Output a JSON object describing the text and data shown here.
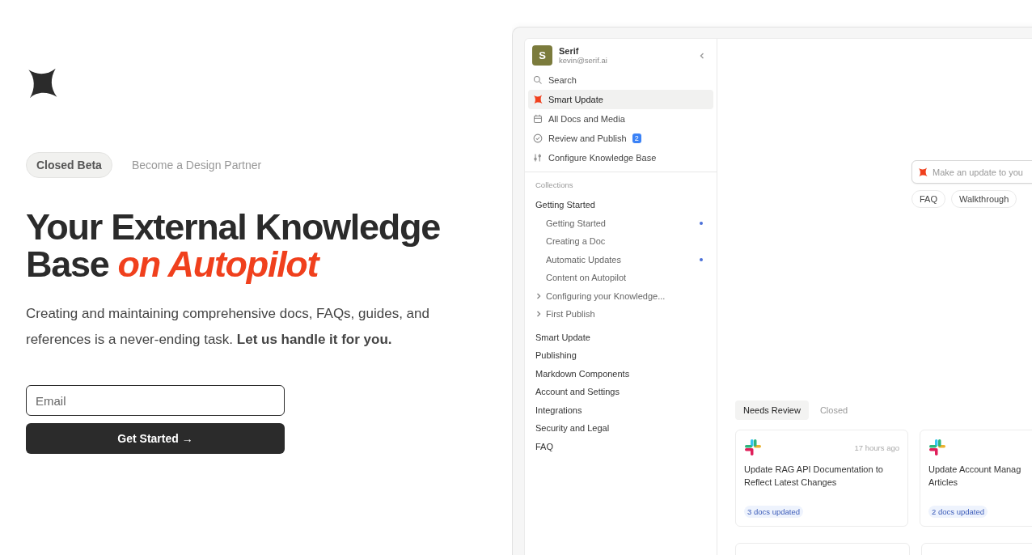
{
  "hero": {
    "tags": [
      {
        "label": "Closed Beta",
        "kind": "badge"
      },
      {
        "label": "Become a Design Partner",
        "kind": "link"
      }
    ],
    "headline": "Your External Knowledge Base",
    "headline_accent": "on Autopilot",
    "description": "Creating and maintaining comprehensive docs, FAQs, guides, and references is a never-ending task. **Let us handle it for you.**",
    "email": {
      "placeholder": "Email"
    },
    "button": "Get Started →"
  },
  "app": {
    "workspace": {
      "initial": "S",
      "name": "Serif",
      "email": "kevin@serif.ai"
    },
    "nav": [
      {
        "label": "Search",
        "kind": "search",
        "selected": false
      },
      {
        "label": "Smart Update",
        "kind": "update",
        "selected": true
      },
      {
        "label": "All Docs and Media",
        "kind": "docs",
        "selected": false
      },
      {
        "label": "Review and Publish",
        "kind": "review",
        "selected": false,
        "badge": "2"
      },
      {
        "label": "Configure Knowledge Base",
        "kind": "configure",
        "selected": false
      }
    ],
    "collections_heading": "Collections",
    "sections": [
      {
        "label": "Getting Started",
        "children": [
          {
            "label": "Getting Started",
            "kind": "page",
            "unread": true
          },
          {
            "label": "Creating a Doc",
            "kind": "page",
            "unread": false
          },
          {
            "label": "Automatic Updates",
            "kind": "page",
            "unread": true
          },
          {
            "label": "Content on Autopilot",
            "kind": "page",
            "unread": false
          },
          {
            "label": "Configuring your Knowledge...",
            "kind": "folder",
            "unread": false
          },
          {
            "label": "First Publish",
            "kind": "folder",
            "unread": false
          }
        ]
      },
      {
        "label": "Smart Update"
      },
      {
        "label": "Publishing"
      },
      {
        "label": "Markdown Components"
      },
      {
        "label": "Account and Settings"
      },
      {
        "label": "Integrations"
      },
      {
        "label": "Security and Legal"
      },
      {
        "label": "FAQ"
      }
    ],
    "prompt": {
      "placeholder": "Make an update to you"
    },
    "chips": [
      "FAQ",
      "Walkthrough"
    ],
    "tabs": [
      {
        "label": "Needs Review",
        "selected": true
      },
      {
        "label": "Closed",
        "selected": false
      }
    ],
    "cards": [
      {
        "time": "17 hours ago",
        "title": "Update RAG API Documentation to Reflect Latest Changes",
        "badge": "3 docs updated"
      },
      {
        "title": "Update Account Manag\nArticles",
        "badge": "2 docs updated"
      }
    ]
  }
}
